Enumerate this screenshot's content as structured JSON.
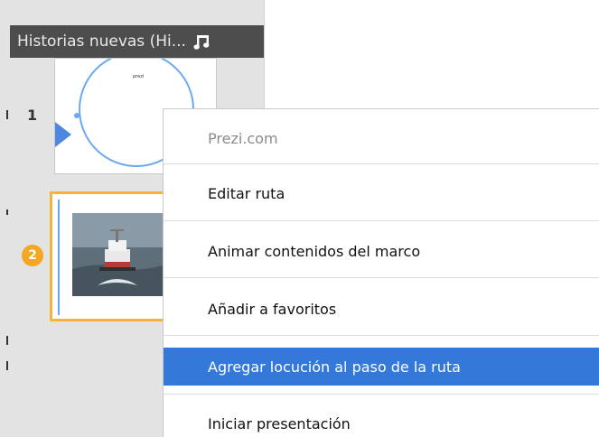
{
  "panel": {
    "title": "Historias nuevas (Hi...",
    "steps": [
      {
        "number": "1",
        "label": "prezi"
      },
      {
        "number": "2"
      }
    ]
  },
  "context_menu": {
    "items": [
      {
        "label": "Prezi.com",
        "state": "disabled"
      },
      {
        "label": "Editar ruta",
        "state": "normal"
      },
      {
        "label": "Animar contenidos del marco",
        "state": "normal"
      },
      {
        "label": "Añadir a favoritos",
        "state": "normal"
      },
      {
        "label": "Agregar locución al paso de la ruta",
        "state": "selected"
      },
      {
        "label": "Iniciar presentación",
        "state": "normal"
      }
    ]
  },
  "colors": {
    "selection": "#3478d9",
    "active_frame": "#f4b437",
    "step_badge": "#f5a623",
    "path_blue": "#6aa9f2",
    "header_bg": "#4d4d4d"
  },
  "icons": {
    "header": "music-note-icon"
  }
}
